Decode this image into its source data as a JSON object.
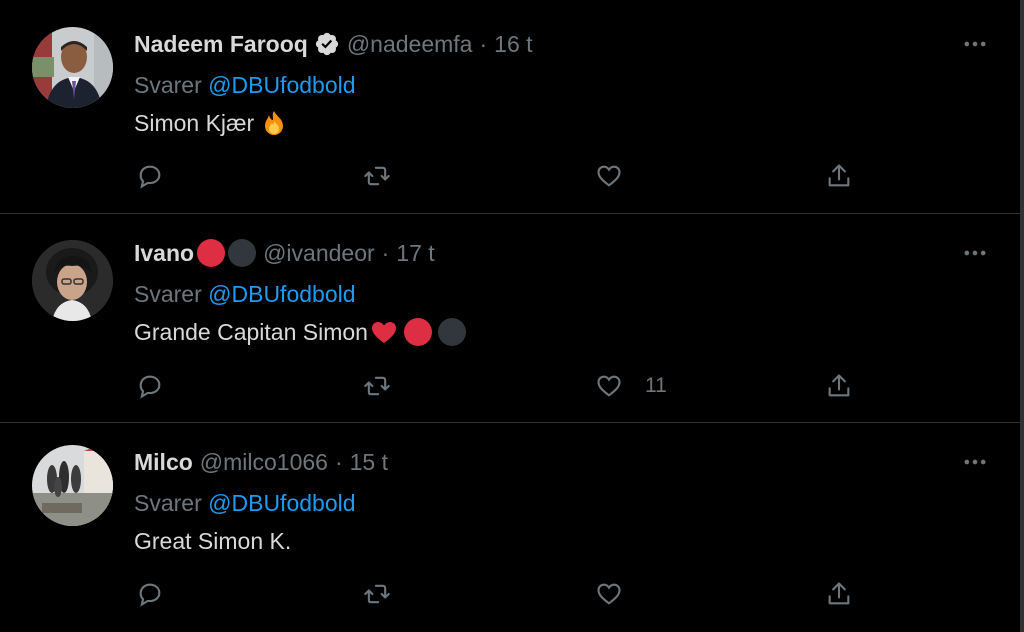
{
  "theme": {
    "background": "#000000",
    "text": "#d9d9d9",
    "secondary": "#6e767d",
    "link": "#1d9bf0",
    "divider": "#2f3336",
    "verified": "#d9d9d9"
  },
  "tweets": [
    {
      "name": "Nadeem Farooq",
      "verified": true,
      "handle": "@nadeemfa",
      "time": "16 t",
      "reply_prefix": "Svarer",
      "reply_to": "@DBUfodbold",
      "text": "Simon Kjær",
      "text_emoji": "fire-emoji",
      "likes": ""
    },
    {
      "name": "Ivano",
      "verified": false,
      "name_emojis": [
        "red-circle-emoji",
        "black-circle-emoji"
      ],
      "handle": "@ivandeor",
      "time": "17 t",
      "reply_prefix": "Svarer",
      "reply_to": "@DBUfodbold",
      "text": "Grande Capitan Simon",
      "text_emojis": [
        "red-heart-emoji",
        "red-circle-emoji",
        "black-circle-emoji"
      ],
      "likes": "11"
    },
    {
      "name": "Milco",
      "verified": false,
      "handle": "@milco1066",
      "time": "15 t",
      "reply_prefix": "Svarer",
      "reply_to": "@DBUfodbold",
      "text": "Great Simon K.",
      "likes": ""
    }
  ],
  "icons": {
    "more": "more-horizontal-icon",
    "reply": "reply-bubble-icon",
    "retweet": "retweet-icon",
    "like": "heart-icon",
    "share": "share-upload-icon"
  }
}
